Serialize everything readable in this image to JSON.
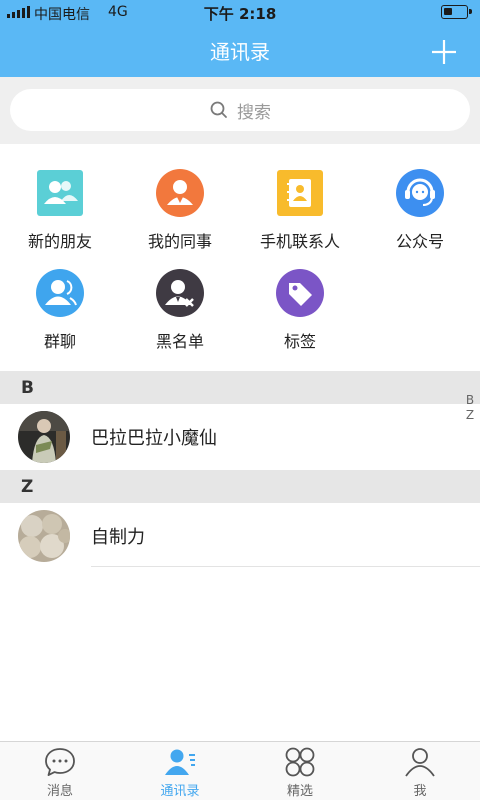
{
  "status_bar": {
    "carrier": "中国电信",
    "network": "4G",
    "time": "下午 2:18"
  },
  "header": {
    "title": "通讯录",
    "add_icon": "plus-icon"
  },
  "search": {
    "placeholder": "搜索",
    "icon": "search-icon"
  },
  "functions": [
    {
      "label": "新的朋友",
      "icon": "new-friends-icon",
      "color": "#5bcfd6"
    },
    {
      "label": "我的同事",
      "icon": "colleagues-icon",
      "color": "#f2783d"
    },
    {
      "label": "手机联系人",
      "icon": "phone-contacts-icon",
      "color": "#f8bb2c"
    },
    {
      "label": "公众号",
      "icon": "official-accounts-icon",
      "color": "#3d8ff0"
    },
    {
      "label": "群聊",
      "icon": "group-chat-icon",
      "color": "#3fa5ee"
    },
    {
      "label": "黑名单",
      "icon": "blacklist-icon",
      "color": "#3f3a43"
    },
    {
      "label": "标签",
      "icon": "tag-icon",
      "color": "#7b55c6"
    }
  ],
  "sections": [
    {
      "letter": "B",
      "contacts": [
        {
          "name": "巴拉巴拉小魔仙"
        }
      ]
    },
    {
      "letter": "Z",
      "contacts": [
        {
          "name": "自制力"
        }
      ]
    }
  ],
  "index_letters": [
    "B",
    "Z"
  ],
  "tabs": [
    {
      "label": "消息",
      "icon": "message-bubble-icon",
      "active": false
    },
    {
      "label": "通讯录",
      "icon": "contacts-icon",
      "active": true
    },
    {
      "label": "精选",
      "icon": "featured-grid-icon",
      "active": false
    },
    {
      "label": "我",
      "icon": "profile-icon",
      "active": false
    }
  ],
  "colors": {
    "header": "#5ab8f5",
    "active_tab": "#43a7ef"
  }
}
